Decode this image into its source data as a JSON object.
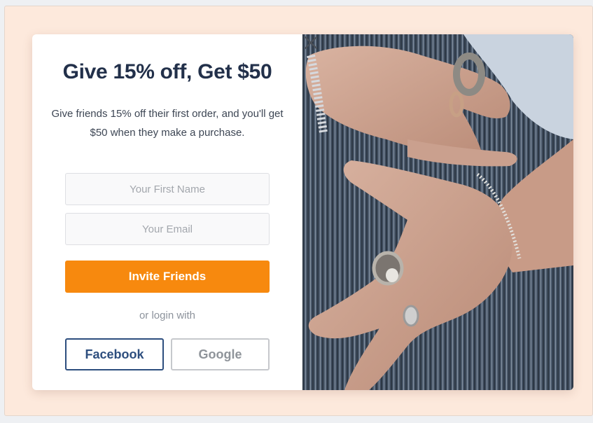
{
  "popup": {
    "title": "Give 15% off, Get $50",
    "subtitle": "Give friends 15% off their first order, and you'll get $50 when they make a purchase.",
    "first_name_placeholder": "Your First Name",
    "email_placeholder": "Your Email",
    "cta_label": "Invite Friends",
    "divider_text": "or login with",
    "facebook_label": "Facebook",
    "google_label": "Google",
    "close_icon": "close-icon"
  },
  "photo": {
    "subject": "hands-with-silver-rings-photo"
  },
  "colors": {
    "backdrop": "#fde9dc",
    "title": "#22304a",
    "cta": "#f7890e",
    "facebook": "#2d4e7e",
    "google_border": "#c6c8cc"
  }
}
